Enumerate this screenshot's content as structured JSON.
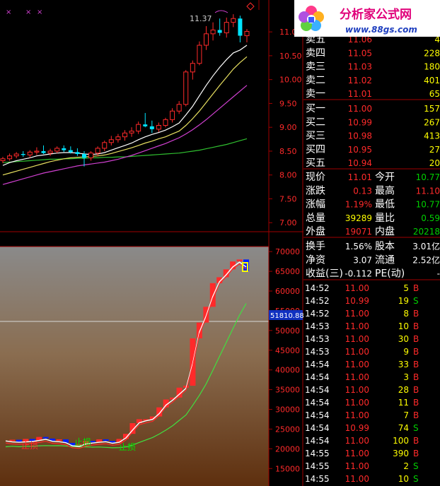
{
  "logo": {
    "title": "分析家公式网",
    "url": "www.88gs.com"
  },
  "upper_chart": {
    "peak_label": "11.37",
    "price_axis": [
      "11.0",
      "10.50",
      "10.00",
      "9.50",
      "9.00",
      "8.50",
      "8.00",
      "7.50",
      "7.00"
    ],
    "price_range": [
      6.9,
      11.55
    ],
    "candles": [
      [
        8.3,
        8.38,
        8.25,
        8.34
      ],
      [
        8.34,
        8.45,
        8.3,
        8.4
      ],
      [
        8.4,
        8.48,
        8.35,
        8.44
      ],
      [
        8.44,
        8.5,
        8.38,
        8.42
      ],
      [
        8.42,
        8.52,
        8.36,
        8.48
      ],
      [
        8.48,
        8.58,
        8.42,
        8.5
      ],
      [
        8.5,
        8.62,
        8.44,
        8.46
      ],
      [
        8.46,
        8.55,
        8.4,
        8.5
      ],
      [
        8.5,
        8.6,
        8.46,
        8.56
      ],
      [
        8.56,
        8.62,
        8.48,
        8.52
      ],
      [
        8.52,
        8.6,
        8.45,
        8.48
      ],
      [
        8.48,
        8.56,
        8.4,
        8.44
      ],
      [
        8.44,
        8.5,
        8.18,
        8.36
      ],
      [
        8.36,
        8.5,
        8.3,
        8.46
      ],
      [
        8.46,
        8.6,
        8.4,
        8.56
      ],
      [
        8.56,
        8.72,
        8.5,
        8.68
      ],
      [
        8.68,
        8.82,
        8.62,
        8.74
      ],
      [
        8.74,
        8.86,
        8.68,
        8.8
      ],
      [
        8.8,
        8.94,
        8.72,
        8.88
      ],
      [
        8.88,
        9.0,
        8.8,
        8.92
      ],
      [
        8.92,
        9.12,
        8.86,
        9.06
      ],
      [
        9.06,
        9.3,
        9.0,
        9.02
      ],
      [
        9.02,
        9.14,
        8.88,
        8.96
      ],
      [
        8.96,
        9.1,
        8.9,
        9.04
      ],
      [
        9.04,
        9.2,
        9.0,
        9.16
      ],
      [
        9.16,
        9.4,
        9.1,
        9.34
      ],
      [
        9.34,
        9.55,
        9.28,
        9.48
      ],
      [
        9.48,
        10.2,
        9.44,
        10.16
      ],
      [
        10.16,
        10.4,
        10.0,
        10.34
      ],
      [
        10.34,
        10.8,
        10.3,
        10.72
      ],
      [
        10.72,
        11.12,
        10.62,
        10.96
      ],
      [
        10.96,
        11.2,
        10.82,
        11.04
      ],
      [
        11.04,
        11.28,
        10.92,
        10.98
      ],
      [
        10.98,
        11.3,
        10.88,
        11.2
      ],
      [
        11.2,
        11.37,
        11.1,
        11.28
      ],
      [
        11.28,
        11.34,
        10.78,
        10.92
      ],
      [
        10.92,
        11.06,
        10.78,
        11.01
      ]
    ],
    "ma_white": [
      8.2,
      8.26,
      8.3,
      8.33,
      8.36,
      8.4,
      8.42,
      8.44,
      8.46,
      8.47,
      8.47,
      8.46,
      8.44,
      8.43,
      8.44,
      8.47,
      8.52,
      8.57,
      8.62,
      8.67,
      8.74,
      8.8,
      8.85,
      8.89,
      8.94,
      9.01,
      9.09,
      9.26,
      9.44,
      9.66,
      9.88,
      10.08,
      10.26,
      10.42,
      10.56,
      10.62,
      10.72
    ],
    "ma_yellow": [
      8.0,
      8.04,
      8.08,
      8.12,
      8.16,
      8.2,
      8.24,
      8.28,
      8.31,
      8.34,
      8.36,
      8.37,
      8.38,
      8.39,
      8.4,
      8.42,
      8.45,
      8.49,
      8.53,
      8.57,
      8.62,
      8.67,
      8.71,
      8.76,
      8.8,
      8.86,
      8.92,
      9.04,
      9.18,
      9.34,
      9.52,
      9.7,
      9.88,
      10.05,
      10.22,
      10.36,
      10.48
    ],
    "ma_magenta": [
      7.8,
      7.84,
      7.88,
      7.92,
      7.96,
      8.0,
      8.04,
      8.07,
      8.1,
      8.13,
      8.16,
      8.19,
      8.21,
      8.23,
      8.25,
      8.27,
      8.3,
      8.33,
      8.37,
      8.41,
      8.46,
      8.51,
      8.56,
      8.61,
      8.66,
      8.72,
      8.78,
      8.86,
      8.95,
      9.05,
      9.16,
      9.28,
      9.4,
      9.52,
      9.64,
      9.76,
      9.88
    ],
    "ma_green": [
      8.26,
      8.27,
      8.28,
      8.29,
      8.3,
      8.31,
      8.32,
      8.33,
      8.33,
      8.34,
      8.34,
      8.35,
      8.35,
      8.36,
      8.36,
      8.37,
      8.37,
      8.38,
      8.38,
      8.39,
      8.4,
      8.41,
      8.42,
      8.43,
      8.44,
      8.45,
      8.46,
      8.48,
      8.5,
      8.52,
      8.55,
      8.58,
      8.61,
      8.64,
      8.68,
      8.72,
      8.76
    ]
  },
  "lower_chart": {
    "axis": [
      "70000",
      "65000",
      "60000",
      "55000",
      "50000",
      "45000",
      "40000",
      "35000",
      "30000",
      "25000",
      "20000",
      "15000"
    ],
    "range": [
      12000,
      72000
    ],
    "marker_value": "51810.88",
    "labels": [
      "止损",
      "止损",
      "止损"
    ]
  },
  "quotes": {
    "sell": [
      {
        "label": "卖五",
        "price": "11.06",
        "vol": "4"
      },
      {
        "label": "卖四",
        "price": "11.05",
        "vol": "228"
      },
      {
        "label": "卖三",
        "price": "11.03",
        "vol": "180"
      },
      {
        "label": "卖二",
        "price": "11.02",
        "vol": "401"
      },
      {
        "label": "卖一",
        "price": "11.01",
        "vol": "65"
      }
    ],
    "buy": [
      {
        "label": "买一",
        "price": "11.00",
        "vol": "157"
      },
      {
        "label": "买二",
        "price": "10.99",
        "vol": "267"
      },
      {
        "label": "买三",
        "price": "10.98",
        "vol": "413"
      },
      {
        "label": "买四",
        "price": "10.95",
        "vol": "27"
      },
      {
        "label": "买五",
        "price": "10.94",
        "vol": "20"
      }
    ],
    "stats": [
      {
        "l1": "现价",
        "v1": "11.01",
        "l2": "今开",
        "v2": "10.77",
        "c1": "#ff2a2a",
        "c2": "#00d000"
      },
      {
        "l1": "涨跌",
        "v1": "0.13",
        "l2": "最高",
        "v2": "11.10",
        "c1": "#ff2a2a",
        "c2": "#ff2a2a"
      },
      {
        "l1": "涨幅",
        "v1": "1.19%",
        "l2": "最低",
        "v2": "10.77",
        "c1": "#ff2a2a",
        "c2": "#00d000"
      },
      {
        "l1": "总量",
        "v1": "39289",
        "l2": "量比",
        "v2": "0.59",
        "c1": "#ffff00",
        "c2": "#00d000"
      },
      {
        "l1": "外盘",
        "v1": "19071",
        "l2": "内盘",
        "v2": "20218",
        "c1": "#ff2a2a",
        "c2": "#00d000"
      }
    ],
    "finance": [
      {
        "l1": "换手",
        "v1": "1.56%",
        "l2": "股本",
        "v2": "3.01亿"
      },
      {
        "l1": "净资",
        "v1": "3.07",
        "l2": "流通",
        "v2": "2.52亿"
      },
      {
        "l1": "收益(三)",
        "v1": "-0.112",
        "l2": "PE(动)",
        "v2": "-"
      }
    ]
  },
  "ticks": [
    {
      "t": "14:52",
      "p": "11.00",
      "v": "5",
      "s": "B"
    },
    {
      "t": "14:52",
      "p": "10.99",
      "v": "19",
      "s": "S"
    },
    {
      "t": "14:52",
      "p": "11.00",
      "v": "8",
      "s": "B"
    },
    {
      "t": "14:53",
      "p": "11.00",
      "v": "10",
      "s": "B"
    },
    {
      "t": "14:53",
      "p": "11.00",
      "v": "30",
      "s": "B"
    },
    {
      "t": "14:53",
      "p": "11.00",
      "v": "9",
      "s": "B"
    },
    {
      "t": "14:54",
      "p": "11.00",
      "v": "33",
      "s": "B"
    },
    {
      "t": "14:54",
      "p": "11.00",
      "v": "3",
      "s": "B"
    },
    {
      "t": "14:54",
      "p": "11.00",
      "v": "28",
      "s": "B"
    },
    {
      "t": "14:54",
      "p": "11.00",
      "v": "11",
      "s": "B"
    },
    {
      "t": "14:54",
      "p": "11.00",
      "v": "7",
      "s": "B"
    },
    {
      "t": "14:54",
      "p": "10.99",
      "v": "74",
      "s": "S"
    },
    {
      "t": "14:54",
      "p": "11.00",
      "v": "100",
      "s": "B"
    },
    {
      "t": "14:55",
      "p": "11.00",
      "v": "390",
      "s": "B"
    },
    {
      "t": "14:55",
      "p": "11.00",
      "v": "2",
      "s": "S"
    },
    {
      "t": "14:55",
      "p": "11.00",
      "v": "10",
      "s": "S"
    }
  ],
  "colors": {
    "up": "#ff2a2a",
    "down": "#00e5ff",
    "grid": "#a00000",
    "axis_text": "#ff2a2a"
  }
}
